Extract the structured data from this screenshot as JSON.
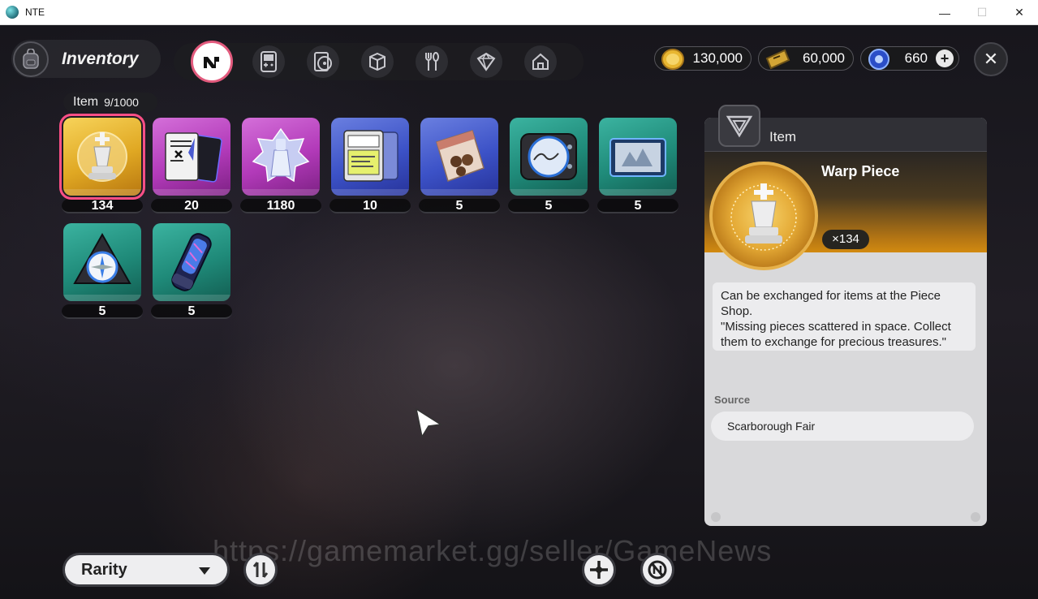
{
  "window": {
    "title": "NTE",
    "minimize": "—",
    "maximize": "☐",
    "close": "✕"
  },
  "header": {
    "title": "Inventory",
    "tabs": [
      {
        "icon": "n-logo-icon",
        "active": true
      },
      {
        "icon": "gameboy-icon",
        "active": false
      },
      {
        "icon": "disc-case-icon",
        "active": false
      },
      {
        "icon": "box-icon",
        "active": false
      },
      {
        "icon": "fork-spoon-icon",
        "active": false
      },
      {
        "icon": "cube-icon",
        "active": false
      },
      {
        "icon": "house-icon",
        "active": false
      }
    ],
    "currencies": [
      {
        "icon": "gold-coin-icon",
        "value": "130,000",
        "color": "#e8b631"
      },
      {
        "icon": "ticket-icon",
        "value": "60,000",
        "color": "#d2a535"
      },
      {
        "icon": "blue-crystal-icon",
        "value": "660",
        "color": "#3e6be0",
        "plus": "+"
      }
    ],
    "close_label": "✕"
  },
  "inventory": {
    "label": "Item",
    "count": "9/1000",
    "items": [
      {
        "name": "Warp Piece",
        "count": "134",
        "rarity": "gold",
        "selected": true
      },
      {
        "name": "card-item",
        "count": "20",
        "rarity": "pink"
      },
      {
        "name": "crystal-item",
        "count": "1180",
        "rarity": "pink"
      },
      {
        "name": "device-item",
        "count": "10",
        "rarity": "blue"
      },
      {
        "name": "snack-bag-item",
        "count": "5",
        "rarity": "blue"
      },
      {
        "name": "gauge-item",
        "count": "5",
        "rarity": "teal"
      },
      {
        "name": "photo-item",
        "count": "5",
        "rarity": "teal"
      },
      {
        "name": "compass-item",
        "count": "5",
        "rarity": "teal"
      },
      {
        "name": "canister-item",
        "count": "5",
        "rarity": "teal"
      }
    ]
  },
  "detail": {
    "section_label": "Item",
    "name": "Warp Piece",
    "quantity": "×134",
    "description_1": "Can be exchanged for items at the Piece Shop.",
    "description_2": "\"Missing pieces scattered in space. Collect them to exchange for precious treasures.\"",
    "source_label": "Source",
    "source_value": "Scarborough Fair"
  },
  "footer": {
    "sort_label": "Rarity"
  },
  "watermark": "https://gamemarket.gg/seller/GameNews"
}
